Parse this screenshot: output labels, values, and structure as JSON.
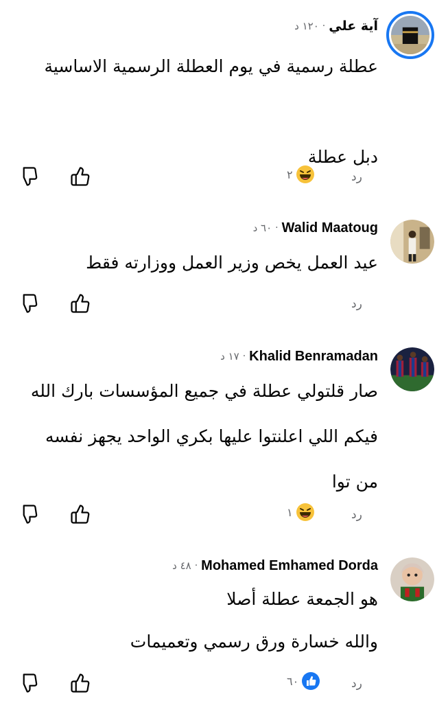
{
  "comments": [
    {
      "author": "آية علي",
      "time": "١٢٠ د",
      "text_lines": [
        "عطلة رسمية في يوم العطلة الرسمية الاساسية",
        "",
        "دبل عطلة"
      ],
      "reaction": {
        "icon": "laughing-face-icon",
        "count": "٢"
      },
      "reply_label": "رد"
    },
    {
      "author": "Walid Maatoug",
      "time": "٦٠ د",
      "text_lines": [
        "عيد العمل يخص وزير العمل ووزارته فقط"
      ],
      "reaction": null,
      "reply_label": "رد"
    },
    {
      "author": "Khalid Benramadan",
      "time": "١٧ د",
      "text_lines": [
        "صار قلتولي عطلة في جميع المؤسسات بارك الله",
        "فيكم اللي اعلنتوا عليها بكري الواحد يجهز نفسه",
        "من توا"
      ],
      "reaction": {
        "icon": "laughing-face-icon",
        "count": "١"
      },
      "reply_label": "رد"
    },
    {
      "author": "Mohamed Emhamed Dorda",
      "time": "٤٨ د",
      "text_lines": [
        "هو الجمعة عطلة أصلا",
        "والله خسارة ورق رسمي وتعميمات"
      ],
      "reaction": {
        "icon": "like-reaction-icon",
        "count": "٦٠"
      },
      "reply_label": "رد"
    }
  ],
  "colors": {
    "accent": "#1877f2",
    "secondary_text": "#65676b",
    "primary_text": "#050505",
    "emoji_yellow": "#f7c23a"
  }
}
